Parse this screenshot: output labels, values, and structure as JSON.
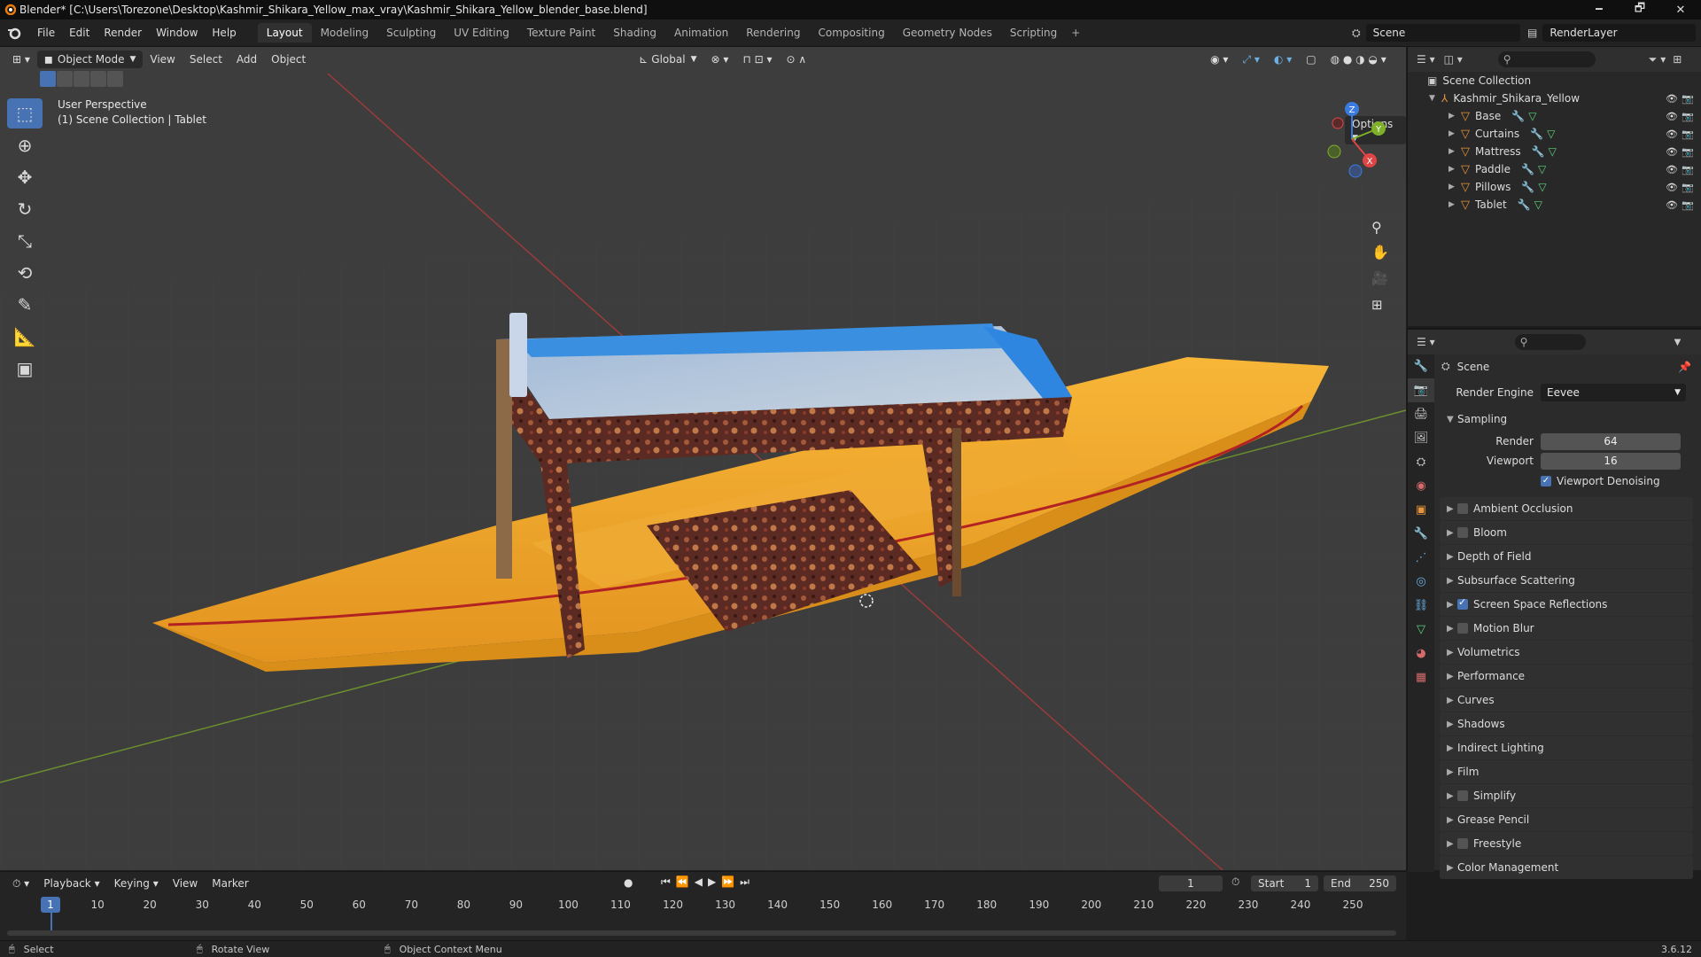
{
  "window": {
    "title": "Blender* [C:\\Users\\Torezone\\Desktop\\Kashmir_Shikara_Yellow_max_vray\\Kashmir_Shikara_Yellow_blender_base.blend]",
    "minimize": "🗕",
    "maximize": "🗗",
    "close": "✕"
  },
  "menu": [
    "File",
    "Edit",
    "Render",
    "Window",
    "Help"
  ],
  "workspaces": [
    "Layout",
    "Modeling",
    "Sculpting",
    "UV Editing",
    "Texture Paint",
    "Shading",
    "Animation",
    "Rendering",
    "Compositing",
    "Geometry Nodes",
    "Scripting"
  ],
  "workspace_add": "+",
  "scene_name": "Scene",
  "render_layer": "RenderLayer",
  "viewport": {
    "mode": "Object Mode",
    "menus": [
      "View",
      "Select",
      "Add",
      "Object"
    ],
    "orientation": "Global",
    "perspective_label": "User Perspective",
    "collection_label": "(1) Scene Collection | Tablet",
    "options": "Options",
    "gizmo_axes": {
      "x": "X",
      "y": "Y",
      "z": "Z"
    }
  },
  "outliner": {
    "root": "Scene Collection",
    "collection": "Kashmir_Shikara_Yellow",
    "objects": [
      "Base",
      "Curtains",
      "Mattress",
      "Paddle",
      "Pillows",
      "Tablet"
    ]
  },
  "properties": {
    "context": "Scene",
    "render_engine_label": "Render Engine",
    "render_engine": "Eevee",
    "sampling": {
      "title": "Sampling",
      "render_label": "Render",
      "render_value": "64",
      "viewport_label": "Viewport",
      "viewport_value": "16",
      "denoise_label": "Viewport Denoising",
      "denoise_checked": true
    },
    "panels": [
      {
        "label": "Ambient Occlusion",
        "checkbox": true,
        "checked": false
      },
      {
        "label": "Bloom",
        "checkbox": true,
        "checked": false
      },
      {
        "label": "Depth of Field",
        "checkbox": false,
        "checked": false
      },
      {
        "label": "Subsurface Scattering",
        "checkbox": false,
        "checked": false
      },
      {
        "label": "Screen Space Reflections",
        "checkbox": true,
        "checked": true
      },
      {
        "label": "Motion Blur",
        "checkbox": true,
        "checked": false
      },
      {
        "label": "Volumetrics",
        "checkbox": false,
        "checked": false
      },
      {
        "label": "Performance",
        "checkbox": false,
        "checked": false
      },
      {
        "label": "Curves",
        "checkbox": false,
        "checked": false
      },
      {
        "label": "Shadows",
        "checkbox": false,
        "checked": false
      },
      {
        "label": "Indirect Lighting",
        "checkbox": false,
        "checked": false
      },
      {
        "label": "Film",
        "checkbox": false,
        "checked": false
      },
      {
        "label": "Simplify",
        "checkbox": true,
        "checked": false
      },
      {
        "label": "Grease Pencil",
        "checkbox": false,
        "checked": false
      },
      {
        "label": "Freestyle",
        "checkbox": true,
        "checked": false
      },
      {
        "label": "Color Management",
        "checkbox": false,
        "checked": false
      }
    ]
  },
  "timeline": {
    "menus": [
      "Playback",
      "Keying",
      "View",
      "Marker"
    ],
    "current_frame": "1",
    "start_label": "Start",
    "start": "1",
    "end_label": "End",
    "end": "250",
    "ticks": [
      "1",
      "10",
      "20",
      "30",
      "40",
      "50",
      "60",
      "70",
      "80",
      "90",
      "100",
      "110",
      "120",
      "130",
      "140",
      "150",
      "160",
      "170",
      "180",
      "190",
      "200",
      "210",
      "220",
      "230",
      "240",
      "250"
    ]
  },
  "statusbar": {
    "select": "Select",
    "rotate": "Rotate View",
    "context_menu": "Object Context Menu",
    "version": "3.6.12"
  },
  "colors": {
    "accent": "#4772b3",
    "boat_yellow": "#f2a82a",
    "canopy_blue": "#4a9fe0",
    "fabric_brown": "#5b2a22"
  }
}
